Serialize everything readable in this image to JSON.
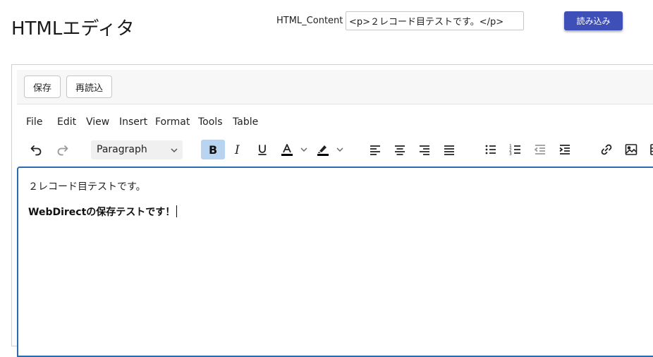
{
  "page": {
    "title": "HTMLエディタ"
  },
  "header": {
    "field_label": "HTML_Content",
    "field_value": "<p>２レコード目テストです。</p>",
    "load_button": "読み込み"
  },
  "actions": {
    "save": "保存",
    "reload": "再読込"
  },
  "menubar": [
    "File",
    "Edit",
    "View",
    "Insert",
    "Format",
    "Tools",
    "Table"
  ],
  "toolbar": {
    "block_format": "Paragraph",
    "bold_active": true,
    "icons": [
      "undo-icon",
      "redo-icon",
      "bold-icon",
      "italic-icon",
      "underline-icon",
      "text-color-icon",
      "highlight-icon",
      "align-left-icon",
      "align-center-icon",
      "align-right-icon",
      "align-justify-icon",
      "bullet-list-icon",
      "numbered-list-icon",
      "outdent-icon",
      "indent-icon",
      "link-icon",
      "image-icon",
      "table-icon"
    ]
  },
  "content": {
    "paragraph_1": "２レコード目テストです。",
    "paragraph_2": "WebDirectの保存テストです！"
  },
  "colors": {
    "accent": "#3f4fb8",
    "editor_focus": "#2a6bb0",
    "bold_active_bg": "#b9d4f0"
  }
}
